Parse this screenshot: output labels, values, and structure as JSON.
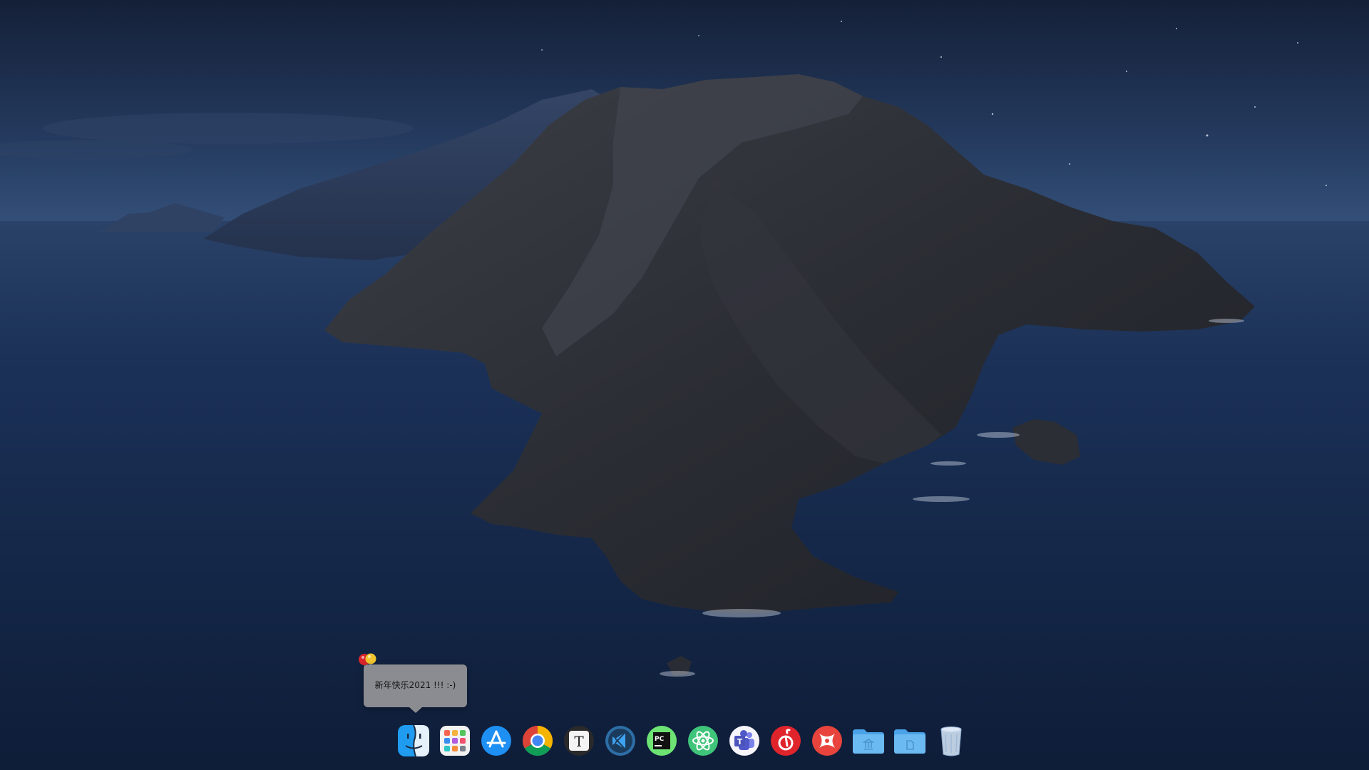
{
  "desktop": {
    "wallpaper": "Catalina island at night"
  },
  "tooltip": {
    "text": "新年快乐2021 !!! :-)"
  },
  "dock": {
    "items": [
      {
        "icon": "finder-icon"
      },
      {
        "icon": "launchpad-icon"
      },
      {
        "icon": "app-store-icon"
      },
      {
        "icon": "chrome-icon"
      },
      {
        "icon": "typora-icon"
      },
      {
        "icon": "vscode-icon"
      },
      {
        "icon": "pycharm-icon"
      },
      {
        "icon": "atom-icon"
      },
      {
        "icon": "teams-icon"
      },
      {
        "icon": "netease-music-icon"
      },
      {
        "icon": "xmind-icon"
      },
      {
        "icon": "applications-folder-icon"
      },
      {
        "icon": "documents-folder-icon"
      },
      {
        "icon": "trash-icon"
      }
    ]
  },
  "colors": {
    "sky": "#1f3152",
    "sea": "#15284a",
    "tooltip": "#969698"
  }
}
